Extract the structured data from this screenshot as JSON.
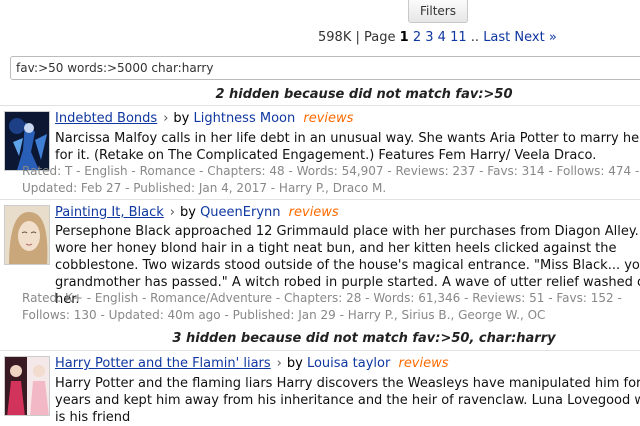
{
  "toolbar": {
    "filters_label": "Filters"
  },
  "pager": {
    "count": "598K",
    "sep": "|",
    "page_word": "Page",
    "current": "1",
    "pages": [
      "2",
      "3",
      "4",
      "11"
    ],
    "ellipsis": "..",
    "last": "Last",
    "next": "Next »"
  },
  "search": {
    "value": "fav:>50 words:>5000 char:harry"
  },
  "notes": [
    "2 hidden because did not match fav:>50",
    "3 hidden because did not match fav:>50, char:harry"
  ],
  "stories": [
    {
      "title": "Indebted Bonds",
      "by": "by",
      "author": "Lightness Moon",
      "reviews": "reviews",
      "desc": "Narcissa Malfoy calls in her life debt in an unusual way. She wants Aria Potter to marry her son for it. (Retake on The Complicated Engagement.) Features Fem Harry/ Veela Draco.",
      "meta": "Rated: T - English - Romance - Chapters: 48 - Words: 54,907 - Reviews: 237 - Favs: 314 - Follows: 474 - Updated: Feb 27 - Published: Jan 4, 2017 - Harry P., Draco M."
    },
    {
      "title": "Painting It, Black",
      "by": "by",
      "author": "QueenErynn",
      "reviews": "reviews",
      "desc": "Persephone Black approached 12 Grimmauld place with her purchases from Diagon Alley. She wore her honey blond hair in a tight neat bun, and her kitten heels clicked against the cobblestone. Two wizards stood outside of the house's magical entrance. \"Miss Black... your grandmother has passed.\" A witch robed in purple started. A wave of utter relief washed over her.",
      "meta": "Rated: K+ - English - Romance/Adventure - Chapters: 28 - Words: 61,346 - Reviews: 51 - Favs: 152 - Follows: 130 - Updated: 40m ago - Published: Jan 29 - Harry P., Sirius B., George W., OC"
    },
    {
      "title": "Harry Potter and the Flamin' liars",
      "by": "by",
      "author": "Louisa taylor",
      "reviews": "reviews",
      "desc": "Harry Potter and the flaming liars Harry discovers the Weasleys have manipulated him for years and kept him away from his inheritance and the heir of ravenclaw. Luna Lovegood who is his friend"
    }
  ]
}
